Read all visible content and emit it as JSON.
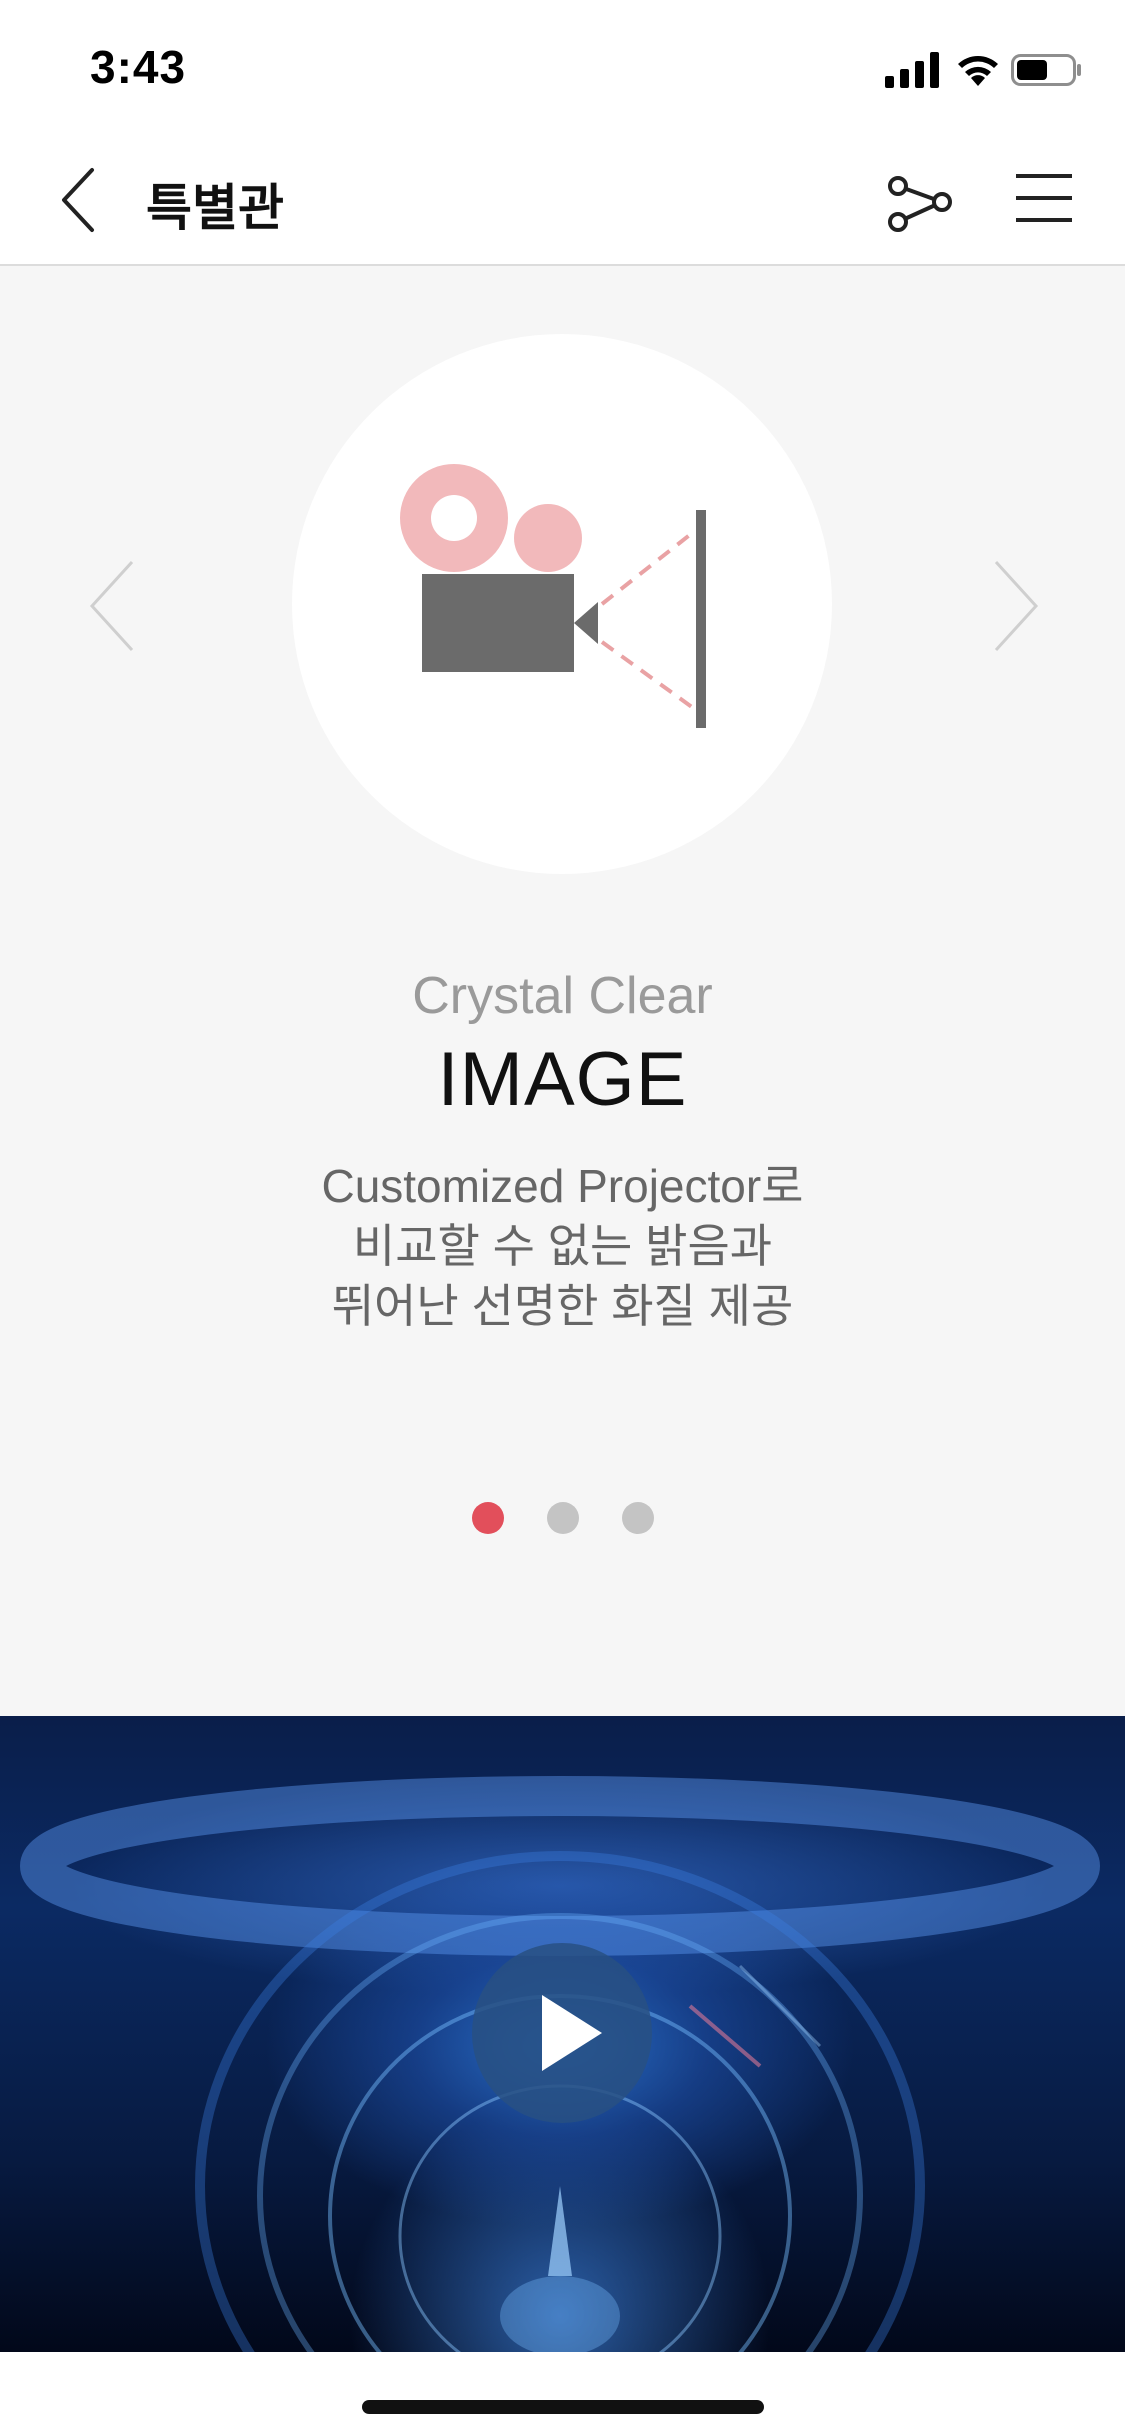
{
  "status_bar": {
    "time": "3:43",
    "icons": [
      "cellular-signal-icon",
      "wifi-icon",
      "battery-icon"
    ]
  },
  "header": {
    "back_icon": "chevron-left-icon",
    "title": "특별관",
    "share_icon": "share-icon",
    "menu_icon": "hamburger-menu-icon"
  },
  "carousel": {
    "prev_icon": "chevron-left-icon",
    "next_icon": "chevron-right-icon",
    "slide_icon": "projector-camera-icon",
    "subtitle": "Crystal Clear",
    "title": "IMAGE",
    "description_lines": [
      "Customized Projector로",
      "비교할 수 없는 밝음과",
      "뛰어난 선명한 화질 제공"
    ],
    "page_count": 3,
    "active_page": 1,
    "colors": {
      "accent": "#e24f5b",
      "pink": "#f2b9bb",
      "camera_gray": "#6b6b6b",
      "dot_inactive": "#c4c4c4"
    }
  },
  "video": {
    "play_icon": "play-icon"
  }
}
